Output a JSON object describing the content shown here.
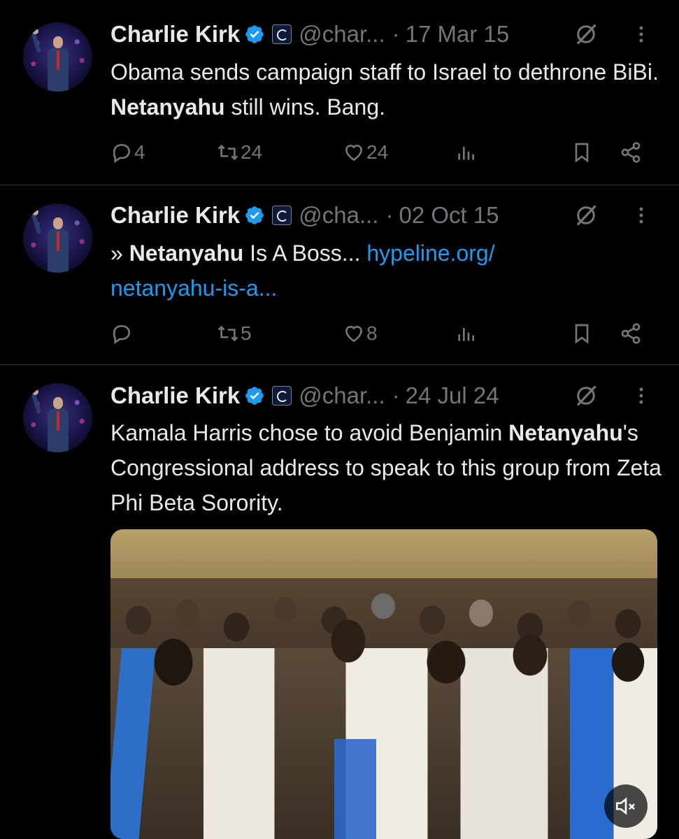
{
  "tweets": [
    {
      "author": "Charlie Kirk",
      "handle": "@char...",
      "separator": "·",
      "date": "17 Mar 15",
      "text_parts": [
        "Obama sends campaign staff to Israel to dethrone BiBi. ",
        "Netanyahu",
        " still wins.  Bang."
      ],
      "replies": "4",
      "reposts": "24",
      "likes": "24"
    },
    {
      "author": "Charlie Kirk",
      "handle": "@cha...",
      "separator": "·",
      "date": "02 Oct 15",
      "text_parts": [
        "» ",
        "Netanyahu",
        " Is A Boss... ",
        "hypeline.org/",
        "netanyahu-is-a..."
      ],
      "replies": "",
      "reposts": "5",
      "likes": "8"
    },
    {
      "author": "Charlie Kirk",
      "handle": "@char...",
      "separator": "·",
      "date": "24 Jul 24",
      "text_parts": [
        "Kamala Harris chose to avoid Benjamin ",
        "Netanyahu",
        "'s Congressional address to speak to this group from Zeta Phi Beta Sorority."
      ]
    }
  ],
  "colors": {
    "background": "#000000",
    "text": "#e7e9ea",
    "muted": "#71767b",
    "link": "#1d9bf0",
    "verified": "#1d9bf0",
    "divider": "#2f3336"
  },
  "icons": {
    "verified": "verified-badge-icon",
    "affiliate": "affiliate-badge-icon",
    "grok": "grok-icon",
    "more": "more-icon",
    "reply": "reply-icon",
    "repost": "repost-icon",
    "like": "like-icon",
    "views": "views-icon",
    "bookmark": "bookmark-icon",
    "share": "share-icon",
    "mute": "mute-icon"
  }
}
